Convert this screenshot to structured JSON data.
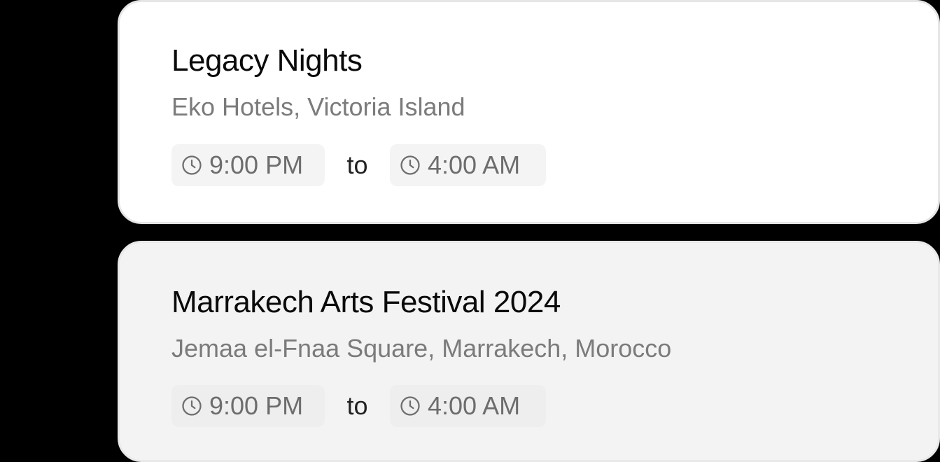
{
  "events": [
    {
      "title": "Legacy Nights",
      "venue": "Eko Hotels, Victoria Island",
      "start_time": "9:00 PM",
      "separator": "to",
      "end_time": "4:00 AM",
      "start_icon": "clock-icon",
      "end_icon": "clock-icon",
      "background": "#ffffff"
    },
    {
      "title": "Marrakech Arts Festival 2024",
      "venue": "Jemaa el-Fnaa Square, Marrakech, Morocco",
      "start_time": "9:00 PM",
      "separator": "to",
      "end_time": "4:00 AM",
      "start_icon": "clock-icon",
      "end_icon": "clock-icon",
      "background": "#f3f3f3"
    }
  ],
  "colors": {
    "page_background": "#000000",
    "title_text": "#0a0a0a",
    "venue_text": "#7b7b7b",
    "time_text": "#6d6d6d",
    "chip_background": "#f4f4f4"
  }
}
